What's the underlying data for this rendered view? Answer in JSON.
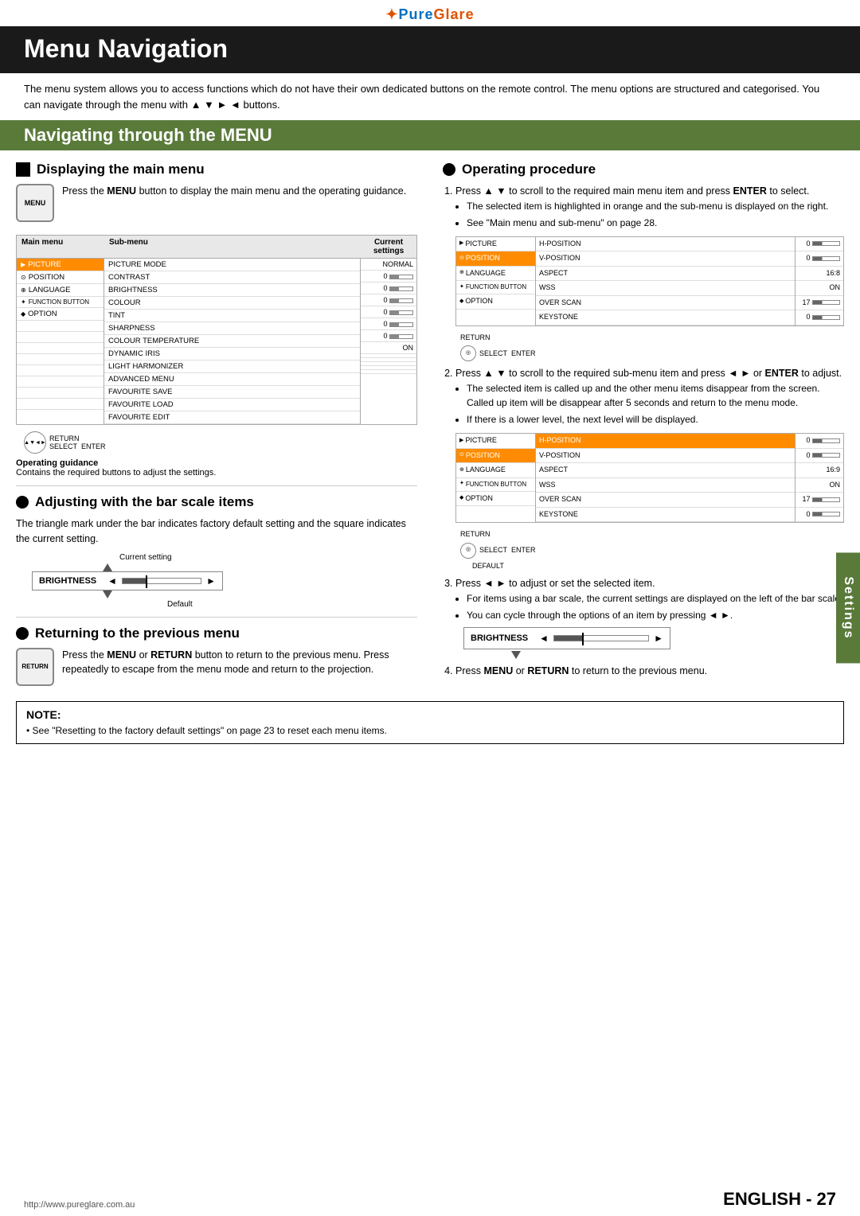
{
  "logo": {
    "text_pure": "Pure",
    "text_glare": "Glare",
    "full": "✦Pure Glare"
  },
  "page_title": "Menu Navigation",
  "intro": {
    "text": "The menu system allows you to access functions which do not have their own dedicated buttons on the remote control. The menu options are structured and categorised. You can navigate through the menu with ▲ ▼ ► ◄ buttons."
  },
  "section": {
    "title": "Navigating through the MENU"
  },
  "left_col": {
    "display_main_menu": {
      "title": "Displaying the main menu",
      "menu_icon_label": "MENU",
      "body": "Press the MENU button to display the main menu and the operating guidance.",
      "table_header": {
        "main": "Main menu",
        "sub": "Sub-menu",
        "current": "Current settings"
      },
      "main_items": [
        {
          "icon": "▶",
          "label": "PICTURE",
          "selected": true
        },
        {
          "icon": "⊙",
          "label": "POSITION",
          "selected": false
        },
        {
          "icon": "⊕",
          "label": "LANGUAGE",
          "selected": false
        },
        {
          "icon": "✦",
          "label": "FUNCTION BUTTON",
          "selected": false
        },
        {
          "icon": "◆",
          "label": "OPTION",
          "selected": false
        }
      ],
      "sub_items": [
        "PICTURE MODE",
        "CONTRAST",
        "BRIGHTNESS",
        "COLOUR",
        "TINT",
        "SHARPNESS",
        "COLOUR TEMPERATURE",
        "DYNAMIC IRIS",
        "LIGHT HARMONIZER",
        "ADVANCED MENU",
        "FAVOURITE SAVE",
        "FAVOURITE LOAD",
        "FAVOURITE EDIT"
      ],
      "cur_items": [
        "NORMAL",
        "0",
        "0",
        "0",
        "0",
        "0",
        "0",
        "ON",
        "",
        "",
        "",
        "",
        ""
      ],
      "op_guidance_title": "Operating guidance",
      "op_guidance_body": "Contains the required buttons to adjust the settings."
    },
    "adjusting": {
      "title": "Adjusting with the bar scale items",
      "body": "The triangle mark under the bar indicates factory default setting and the square indicates the current setting.",
      "current_setting_label": "Current setting",
      "default_label": "Default",
      "brightness_label": "BRIGHTNESS"
    },
    "returning": {
      "title": "Returning to the previous menu",
      "return_icon_label": "RETURN",
      "body": "Press the MENU or RETURN button to return to the previous menu. Press repeatedly to escape from the menu mode and return to the projection."
    }
  },
  "right_col": {
    "operating_procedure": {
      "title": "Operating procedure",
      "step1_text": "Press ▲ ▼ to scroll to the required main menu item and press ENTER to select.",
      "bullet1": "The selected item is highlighted in orange and the sub-menu is displayed on the right.",
      "bullet2": "See \"Main menu and sub-menu\" on page 28.",
      "menu1_main": [
        {
          "icon": "▶",
          "label": "PICTURE"
        },
        {
          "icon": "⊙",
          "label": "POSITION",
          "selected": true
        },
        {
          "icon": "⊕",
          "label": "LANGUAGE"
        },
        {
          "icon": "✦",
          "label": "FUNCTION BUTTON"
        },
        {
          "icon": "◆",
          "label": "OPTION"
        }
      ],
      "menu1_sub": [
        {
          "label": "H-POSITION"
        },
        {
          "label": "V-POSITION"
        },
        {
          "label": "ASPECT"
        },
        {
          "label": "WSS"
        },
        {
          "label": "OVER SCAN"
        },
        {
          "label": "KEYSTONE"
        }
      ],
      "menu1_vals": [
        "0",
        "0",
        "16:8",
        "ON",
        "17",
        "0"
      ],
      "step2_text": "Press ▲ ▼ to scroll to the required sub-menu item and press ◄ ► or ENTER to adjust.",
      "bullet3": "The selected item is called up and the other menu items disappear from the screen. Called up item will be disappear after 5 seconds and return to the menu mode.",
      "bullet4": "If there is a lower level, the next level will be displayed.",
      "menu2_main": [
        {
          "icon": "▶",
          "label": "PICTURE"
        },
        {
          "icon": "⊙",
          "label": "POSITION",
          "selected": true
        },
        {
          "icon": "⊕",
          "label": "LANGUAGE"
        },
        {
          "icon": "✦",
          "label": "FUNCTION BUTTON"
        },
        {
          "icon": "◆",
          "label": "OPTION"
        }
      ],
      "menu2_sub": [
        {
          "label": "H-POSITION",
          "selected": true
        },
        {
          "label": "V-POSITION"
        },
        {
          "label": "ASPECT"
        },
        {
          "label": "WSS"
        },
        {
          "label": "OVER SCAN"
        },
        {
          "label": "KEYSTONE"
        }
      ],
      "menu2_vals": [
        "0",
        "0",
        "16:9",
        "ON",
        "17",
        "0"
      ],
      "step3_text": "Press ◄ ► to adjust or set the selected item.",
      "bullet5": "For items using a bar scale, the current settings are displayed on the left of the bar scale.",
      "bullet6": "You can cycle through the options of an item by pressing ◄ ►.",
      "step4_text": "Press MENU or RETURN to return to the previous menu.",
      "brightness_label": "BRIGHTNESS"
    }
  },
  "note": {
    "title": "NOTE:",
    "bullet": "See \"Resetting to the factory default settings\" on page 23 to reset each menu items."
  },
  "footer": {
    "url": "http://www.pureglare.com.au",
    "page_label": "ENGLISH - 27",
    "eng_label": "ENGLISH",
    "page_num": "27",
    "settings_tab": "Settings"
  }
}
